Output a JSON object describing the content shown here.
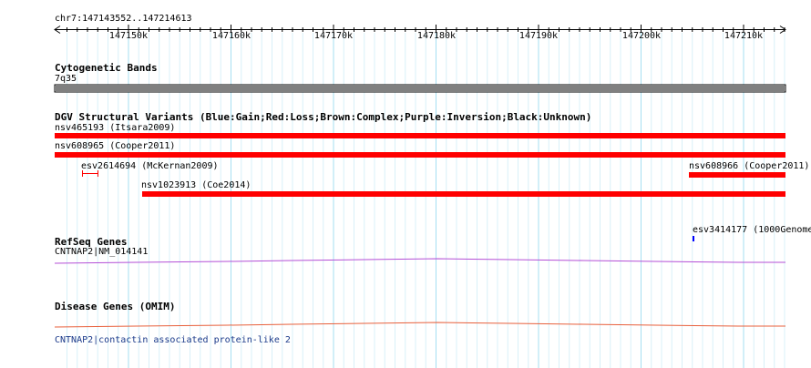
{
  "coordinate_label": "chr7:147143552..147214613",
  "ruler": {
    "ticks": [
      "147150k",
      "147160k",
      "147170k",
      "147180k",
      "147190k",
      "147200k",
      "147210k"
    ]
  },
  "tracks": {
    "cytoband": {
      "title": "Cytogenetic Bands",
      "band_label": "7q35",
      "band_color": "#808080"
    },
    "dgv": {
      "title": "DGV Structural Variants (Blue:Gain;Red:Loss;Brown:Complex;Purple:Inversion;Black:Unknown)",
      "loss_color": "#ff0000",
      "gain_color": "#0000ff",
      "features": [
        {
          "label": "nsv465193 (Itsara2009)"
        },
        {
          "label": "nsv608965 (Cooper2011)"
        },
        {
          "label": "esv2614694 (McKernan2009)"
        },
        {
          "label": "nsv608966 (Cooper2011)"
        },
        {
          "label": "nsv1023913 (Coe2014)"
        },
        {
          "label": "esv3414177 (1000Genome"
        }
      ]
    },
    "refseq": {
      "title": "RefSeq Genes",
      "gene_label": "CNTNAP2|NM_014141",
      "line_color": "#b44fd6"
    },
    "omim": {
      "title": "Disease Genes (OMIM)",
      "gene_label": "CNTNAP2|contactin associated protein-like 2",
      "line_color": "#e8603c",
      "link_color": "#1b3a8a"
    }
  }
}
